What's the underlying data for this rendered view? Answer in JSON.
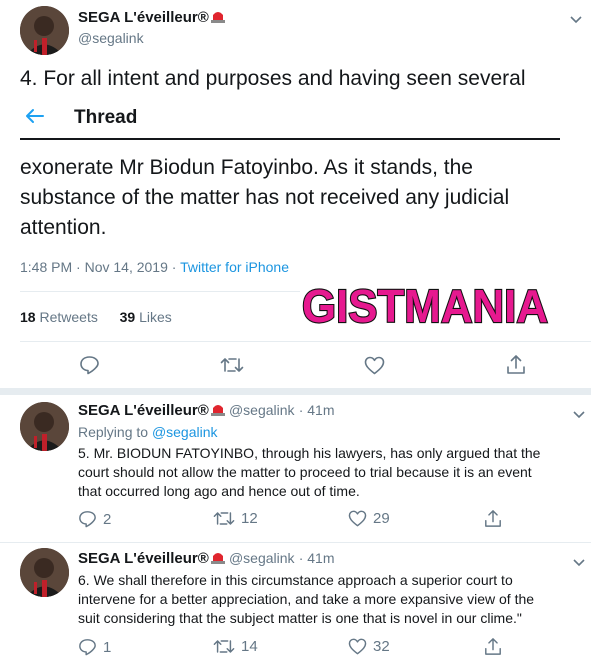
{
  "main_tweet": {
    "author_name": "SEGA L'éveilleur®",
    "handle": "@segalink",
    "text_top": "4. For all intent and purposes and having seen several",
    "text_body": [
      "exonerate Mr Biodun Fatoyinbo. As it stands, the",
      "substance of the matter has not received any judicial",
      "attention."
    ],
    "time": "1:48 PM · Nov 14, 2019 · ",
    "source": "Twitter for iPhone",
    "retweets_count": "18",
    "retweets_label": "Retweets",
    "likes_count": "39",
    "likes_label": "Likes"
  },
  "thread_header": {
    "title": "Thread"
  },
  "watermark": "GISTMANIA",
  "replies": [
    {
      "author_name": "SEGA L'éveilleur®",
      "handle": "@segalink",
      "time": "· 41m",
      "replying_label": "Replying to ",
      "replying_to": "@segalink",
      "lines": [
        "5. Mr. BIODUN FATOYINBO, through his lawyers, has only argued that the",
        "court should not allow the matter to proceed to trial because it is an event",
        "that occurred long ago and hence out of time."
      ],
      "reply_count": "2",
      "retweet_count": "12",
      "like_count": "29"
    },
    {
      "author_name": "SEGA L'éveilleur®",
      "handle": "@segalink",
      "time": "· 41m",
      "lines": [
        "6. We shall therefore in this circumstance approach a superior court to",
        "intervene for a better appreciation, and take a more expansive view of the",
        "suit considering that the subject matter is one that is novel in our clime.\""
      ],
      "reply_count": "1",
      "retweet_count": "14",
      "like_count": "32"
    }
  ],
  "colors": {
    "accent": "#1da1f2",
    "muted": "#657786",
    "watermark_fill": "#e6198f"
  }
}
